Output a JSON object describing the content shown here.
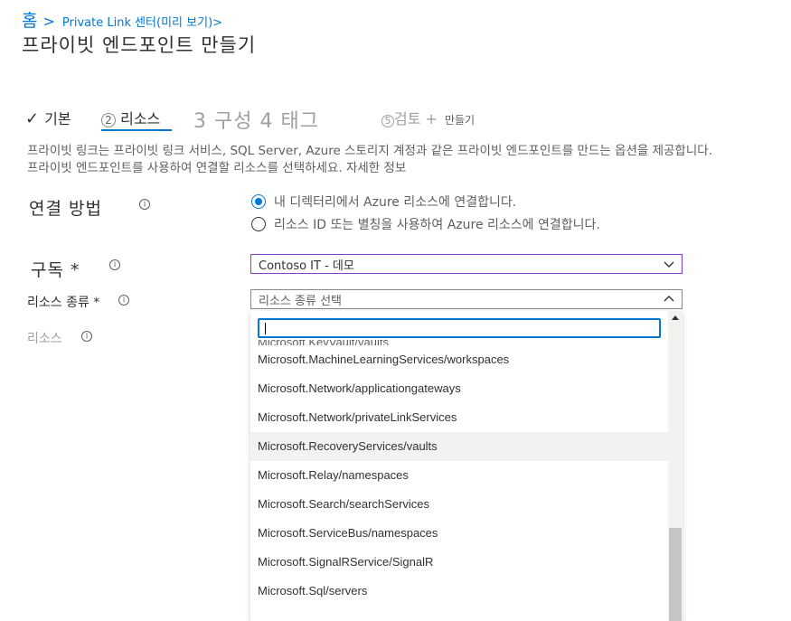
{
  "breadcrumb": {
    "home": "홈",
    "separator": ">",
    "current": "Private  Link 센터(미리 보기)>"
  },
  "page_title": "프라이빗 엔드포인트 만들기",
  "tabs": {
    "basic": "기본",
    "resource_num": "2",
    "resource": "리소스",
    "config": "3 구성 4 태그",
    "review_num": "5",
    "review": "검토 +",
    "create": "만들기"
  },
  "description": "프라이빗 링크는 프라이빗 링크 서비스, SQL Server, Azure 스토리지 계정과 같은 프라이빗 엔드포인트를 만드는 옵션을 제공합니다. 프라이빗 엔드포인트를 사용하여 연결할 리소스를 선택하세요. 자세한 정보",
  "connection_method": {
    "label": "연결 방법",
    "options": [
      "내 디렉터리에서 Azure 리소스에 연결합니다.",
      "리소스 ID 또는 별칭을 사용하여 Azure 리소스에 연결합니다."
    ],
    "selected_index": 0
  },
  "subscription": {
    "label": "구독 *",
    "value": "Contoso IT -  데모"
  },
  "resource_type": {
    "label": "리소스 종류 *",
    "placeholder": "리소스 종류 선택",
    "search_value": ""
  },
  "resource": {
    "label": "리소스"
  },
  "dropdown": {
    "items": [
      "Microsoft.KeyVault/vaults",
      "Microsoft.MachineLearningServices/workspaces",
      "Microsoft.Network/applicationgateways",
      "Microsoft.Network/privateLinkServices",
      "Microsoft.RecoveryServices/vaults",
      "Microsoft.Relay/namespaces",
      "Microsoft.Search/searchServices",
      "Microsoft.ServiceBus/namespaces",
      "Microsoft.SignalRService/SignalR",
      "Microsoft.Sql/servers"
    ],
    "hover_index": 4
  },
  "colors": {
    "accent": "#0078d4",
    "focus_border": "#8a3bd6",
    "text": "#323130"
  }
}
